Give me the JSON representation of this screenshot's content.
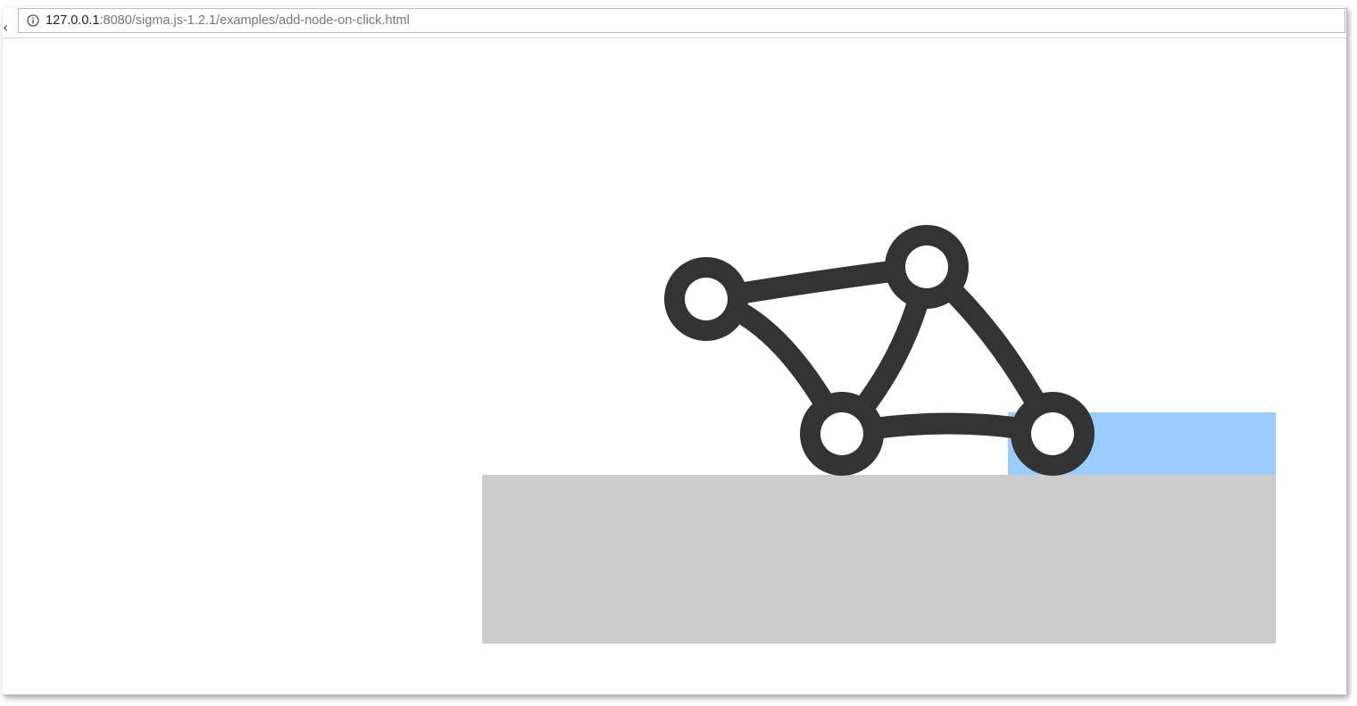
{
  "browser": {
    "url_host": "127.0.0.1",
    "url_path": ":8080/sigma.js-1.2.1/examples/add-node-on-click.html",
    "info_icon": "info-icon",
    "back_glyph": "‹"
  },
  "page": {
    "logo_icon": "sigma-graph-logo-icon",
    "colors": {
      "container": "#cccccc",
      "highlight": "#99ccff",
      "logo": "#333333"
    }
  }
}
